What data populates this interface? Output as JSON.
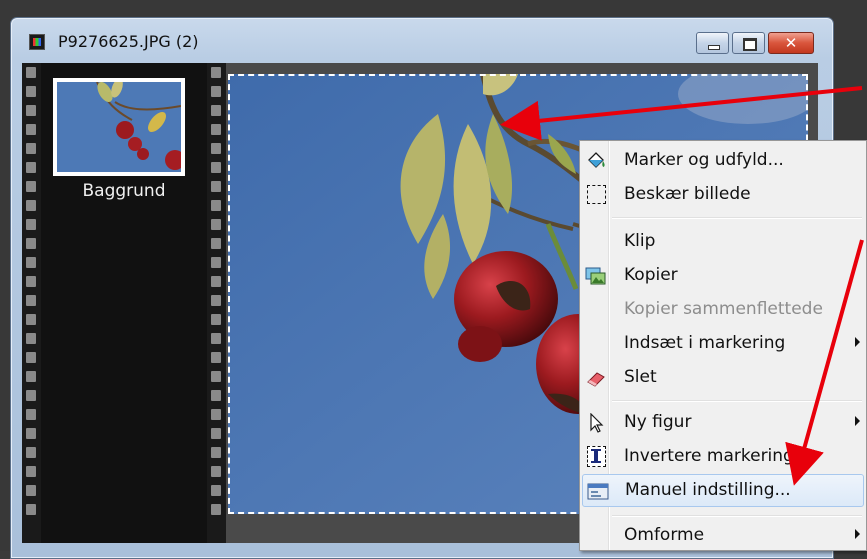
{
  "window": {
    "title": "P9276625.JPG (2)",
    "buttons": {
      "minimize": "minimize",
      "maximize": "maximize",
      "close": "✕"
    }
  },
  "layers": {
    "items": [
      {
        "label": "Baggrund",
        "thumbnail_icon": "rosehip-photo-thumbnail"
      }
    ]
  },
  "context_menu": {
    "items": [
      {
        "label": "Marker og udfyld...",
        "icon": "paint-bucket-icon",
        "enabled": true,
        "submenu": false
      },
      {
        "label": "Beskær billede",
        "icon": "crop-icon",
        "enabled": true,
        "submenu": false
      },
      {
        "label": "Klip",
        "icon": "",
        "enabled": true,
        "submenu": false
      },
      {
        "label": "Kopier",
        "icon": "copy-image-icon",
        "enabled": true,
        "submenu": false
      },
      {
        "label": "Kopier sammenflettede",
        "icon": "",
        "enabled": false,
        "submenu": false
      },
      {
        "label": "Indsæt i markering",
        "icon": "",
        "enabled": true,
        "submenu": true
      },
      {
        "label": "Slet",
        "icon": "eraser-icon",
        "enabled": true,
        "submenu": false
      },
      {
        "label": "Ny figur",
        "icon": "pointer-icon",
        "enabled": true,
        "submenu": true
      },
      {
        "label": "Invertere markering",
        "icon": "invert-selection-icon",
        "enabled": true,
        "submenu": false
      },
      {
        "label": "Manuel indstilling...",
        "icon": "dialog-icon",
        "enabled": true,
        "submenu": false,
        "highlighted": true
      },
      {
        "label": "Omforme",
        "icon": "",
        "enabled": true,
        "submenu": true
      }
    ]
  },
  "colors": {
    "sky": "#4f77b0",
    "berry": "#9c1a1f",
    "annotation_arrow": "#e8000b"
  }
}
